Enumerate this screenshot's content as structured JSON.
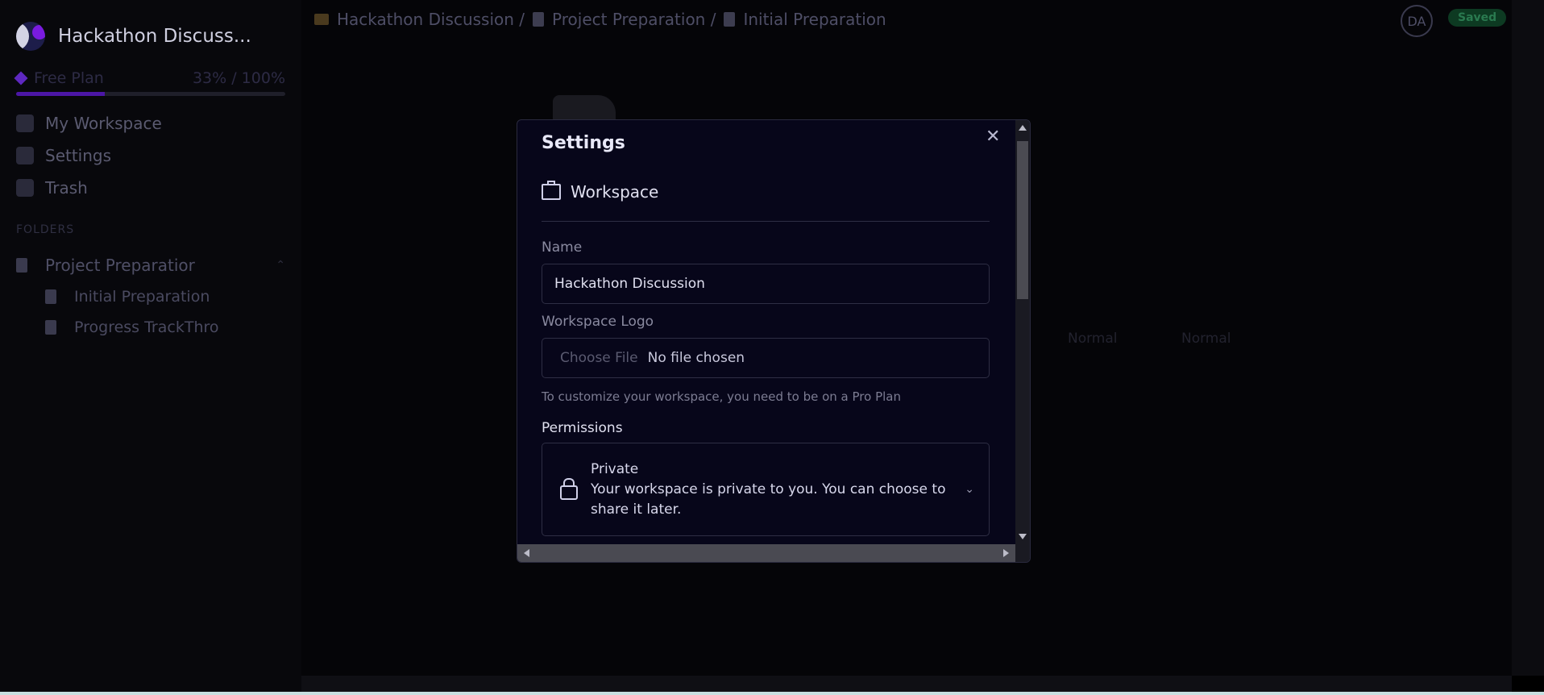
{
  "sidebar": {
    "workspace_name": "Hackathon Discuss...",
    "plan_label": "Free Plan",
    "plan_usage": "33% / 100%",
    "plan_usage_fraction": 0.33,
    "nav": [
      {
        "label": "My Workspace",
        "icon": "home-icon"
      },
      {
        "label": "Settings",
        "icon": "gear-icon"
      },
      {
        "label": "Trash",
        "icon": "trash-icon"
      }
    ],
    "folders_label": "FOLDERS",
    "folder": "Project Preparatior",
    "files": [
      "Initial Preparation",
      "Progress TrackThro"
    ]
  },
  "header": {
    "breadcrumb": [
      "Hackathon Discussion /",
      "Project Preparation /",
      "Initial Preparation"
    ],
    "avatar": "DA",
    "status": "Saved"
  },
  "editor": {
    "formats": [
      "Normal",
      "Normal"
    ]
  },
  "modal": {
    "title": "Settings",
    "section": "Workspace",
    "name_label": "Name",
    "name_value": "Hackathon Discussion",
    "logo_label": "Workspace Logo",
    "choose_file": "Choose File",
    "no_file": "No file chosen",
    "hint": "To customize your workspace, you need to be on a Pro Plan",
    "permissions_label": "Permissions",
    "permission_title": "Private",
    "permission_desc": "Your workspace is private to you. You can choose to share it later."
  },
  "colors": {
    "accent": "#7a1be0",
    "saved_bg": "#0d3a22"
  }
}
